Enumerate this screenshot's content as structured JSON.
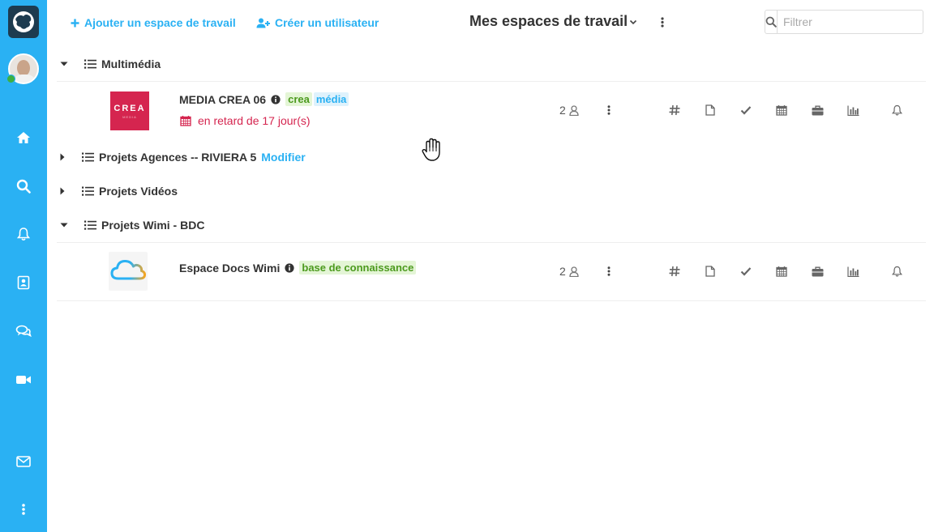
{
  "toolbar": {
    "add_workspace_label": "Ajouter un espace de travail",
    "create_user_label": "Créer un utilisateur",
    "title": "Mes espaces de travail",
    "filter_placeholder": "Filtrer"
  },
  "groups": [
    {
      "name": "Multimédia",
      "expanded": true,
      "workspaces": [
        {
          "name": "MEDIA CREA 06",
          "thumb_text": "CREA",
          "thumb_sub": "MEDIA",
          "tags": [
            {
              "label": "crea",
              "color": "green"
            },
            {
              "label": "média",
              "color": "blue"
            }
          ],
          "late_text": "en retard de 17 jour(s)",
          "members": "2"
        }
      ]
    },
    {
      "name": "Projets Agences -- RIVIERA 5",
      "expanded": false,
      "edit_label": "Modifier"
    },
    {
      "name": "Projets Vidéos",
      "expanded": false
    },
    {
      "name": "Projets Wimi - BDC",
      "expanded": true,
      "workspaces": [
        {
          "name": "Espace Docs Wimi",
          "tags": [
            {
              "label": "base de connaissance",
              "color": "green"
            }
          ],
          "members": "2"
        }
      ]
    }
  ],
  "sidebar_icons": [
    "home-icon",
    "search-icon",
    "bell-icon",
    "contacts-icon",
    "chat-icon",
    "video-icon",
    "mail-icon",
    "more-icon"
  ],
  "workspace_app_icons": [
    "channels-icon",
    "documents-icon",
    "tasks-icon",
    "calendar-icon",
    "projects-icon",
    "stats-icon",
    "notifications-icon"
  ],
  "colors": {
    "sidebar": "#2ab1f3",
    "accent": "#2ab1f3",
    "late": "#d5254f",
    "tag_green_bg": "#e4f5d6",
    "tag_green_text": "#4c9a1e",
    "tag_blue_bg": "#dff2fc",
    "crea_brand": "#d5254f"
  }
}
